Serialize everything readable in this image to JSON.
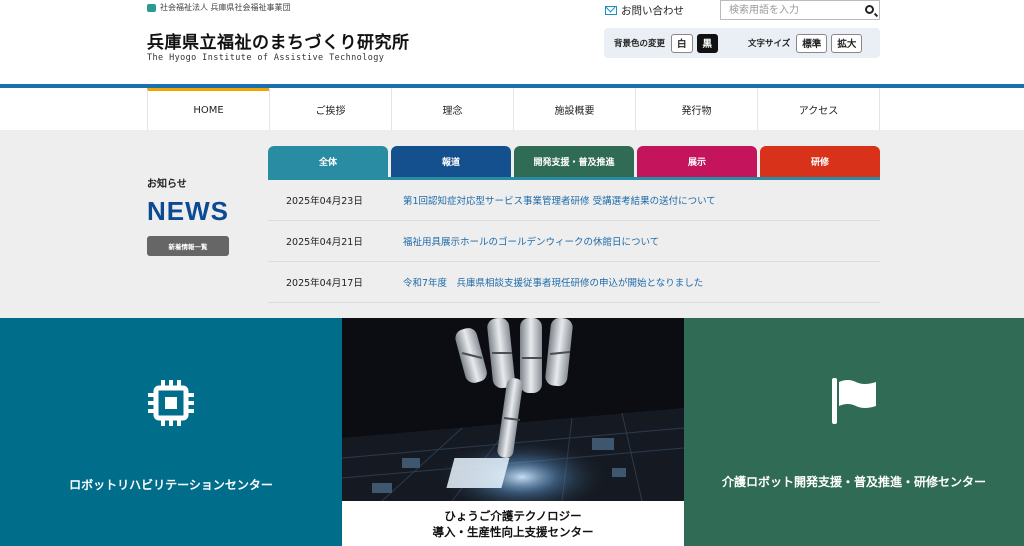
{
  "header": {
    "org_label": "社会福祉法人 兵庫県社会福祉事業団",
    "title": "兵庫県立福祉のまちづくり研究所",
    "subtitle": "The Hyogo Institute of Assistive Technology",
    "contact_label": "お問い合わせ",
    "search_placeholder": "検索用語を入力",
    "bg_label": "背景色の変更",
    "bg_white": "白",
    "bg_black": "黒",
    "font_label": "文字サイズ",
    "font_standard": "標準",
    "font_large": "拡大"
  },
  "nav": {
    "items": [
      "HOME",
      "ご挨拶",
      "理念",
      "施設概要",
      "発行物",
      "アクセス"
    ]
  },
  "news": {
    "small_label": "お知らせ",
    "big_label": "NEWS",
    "list_button": "新着情報一覧",
    "tabs": [
      {
        "label": "全体",
        "color": "#2a8ca3"
      },
      {
        "label": "報道",
        "color": "#13508d"
      },
      {
        "label": "開発支援・普及推進",
        "color": "#2f6b55"
      },
      {
        "label": "展示",
        "color": "#c4145c"
      },
      {
        "label": "研修",
        "color": "#d8321a"
      }
    ],
    "items": [
      {
        "date": "2025年04月23日",
        "title": "第1回認知症対応型サービス事業管理者研修 受講選考結果の送付について"
      },
      {
        "date": "2025年04月21日",
        "title": "福祉用具展示ホールのゴールデンウィークの休館日について"
      },
      {
        "date": "2025年04月17日",
        "title": "令和7年度　兵庫県相談支援従事者現任研修の申込が開始となりました"
      }
    ]
  },
  "panels": {
    "left_title": "ロボットリハビリテーションセンター",
    "mid_line1": "ひょうご介護テクノロジー",
    "mid_line2": "導入・生産性向上支援センター",
    "right_title": "介護ロボット開発支援・普及推進・研修センター"
  }
}
